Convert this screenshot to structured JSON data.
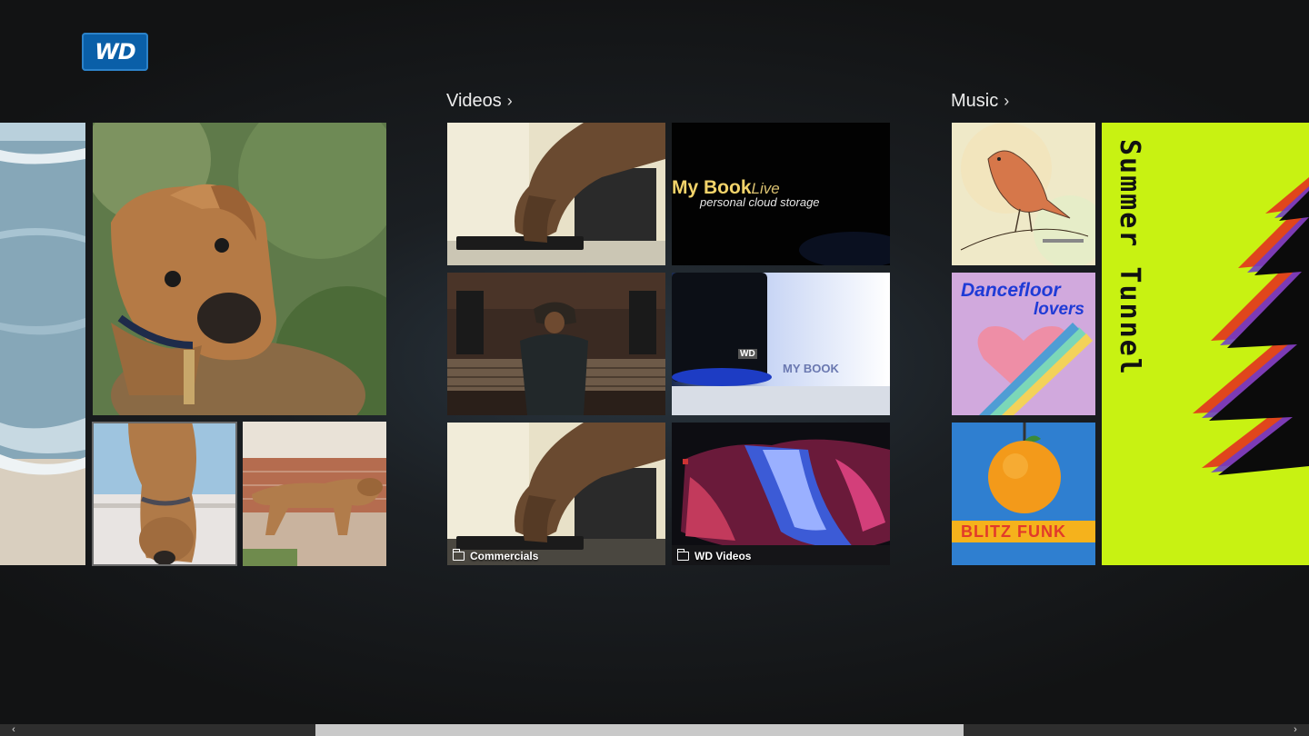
{
  "app": {
    "logo_text": "WD"
  },
  "sections": {
    "videos": {
      "label": "Videos",
      "chevron": "›"
    },
    "music": {
      "label": "Music",
      "chevron": "›"
    }
  },
  "videos": {
    "tile2": {
      "title": "My Book",
      "title_suffix": "Live",
      "subtitle": "personal cloud storage"
    },
    "tile4": {
      "brand_text": "WD",
      "product_text": "MY BOOK"
    },
    "folders": [
      {
        "label": "Commercials",
        "icon": "folder-icon"
      },
      {
        "label": "WD Videos",
        "icon": "folder-icon"
      }
    ]
  },
  "music": {
    "albums": [
      {
        "name": "bird-album-art",
        "caption": ""
      },
      {
        "title_line1": "Dancefloor",
        "title_line2": "lovers"
      },
      {
        "title": "BLITZ FUNK"
      },
      {
        "title": "Summer Tunnel"
      }
    ]
  },
  "scrollbar": {
    "left_arrow": "‹",
    "right_arrow": "›"
  },
  "colors": {
    "logo_blue": "#0a5fa8",
    "summer_bg": "#c8f212",
    "dancefloor_bg": "#c9a0d8",
    "blitz_bg": "#2f7fd0"
  }
}
